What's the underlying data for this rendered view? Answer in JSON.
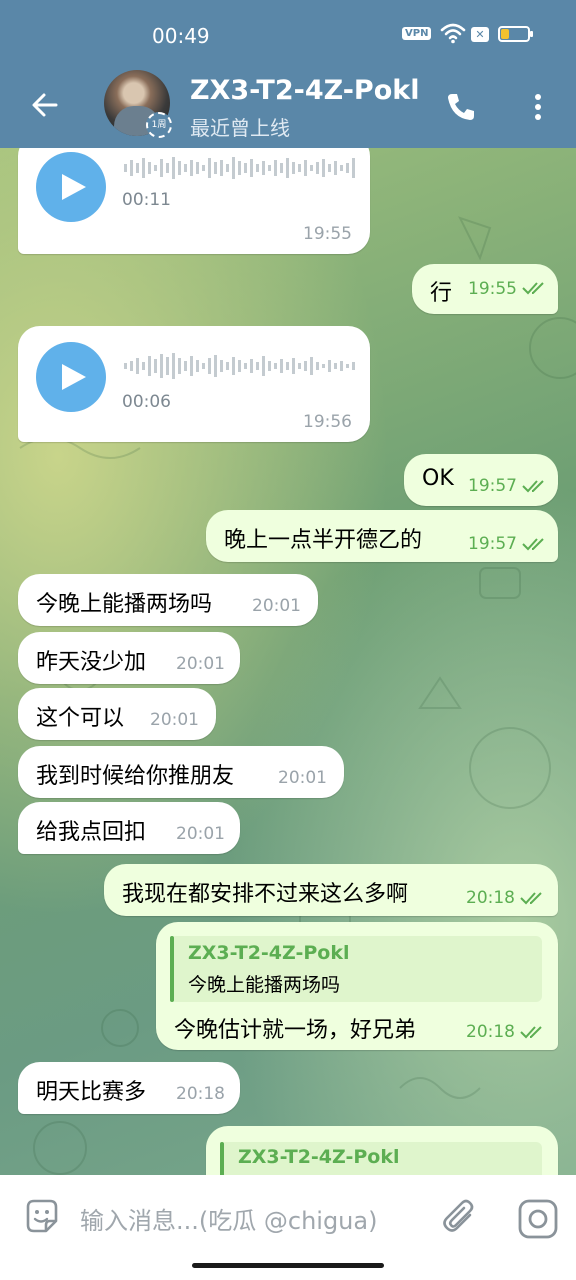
{
  "status_bar": {
    "time": "00:49",
    "vpn": "VPN"
  },
  "header": {
    "title": "ZX3-T2-4Z-Pokl",
    "subtitle": "最近曾上线",
    "badge": "1周"
  },
  "messages": [
    {
      "type": "voice",
      "dir": "in",
      "duration": "00:11",
      "time": "19:55"
    },
    {
      "type": "text",
      "dir": "out",
      "text": "行",
      "time": "19:55"
    },
    {
      "type": "voice",
      "dir": "in",
      "duration": "00:06",
      "time": "19:56"
    },
    {
      "type": "text",
      "dir": "out",
      "text": "OK",
      "time": "19:57"
    },
    {
      "type": "text",
      "dir": "out",
      "text": "晚上一点半开德乙的",
      "time": "19:57"
    },
    {
      "type": "text",
      "dir": "in",
      "text": "今晚上能播两场吗",
      "time": "20:01"
    },
    {
      "type": "text",
      "dir": "in",
      "text": "昨天没少加",
      "time": "20:01"
    },
    {
      "type": "text",
      "dir": "in",
      "text": "这个可以",
      "time": "20:01"
    },
    {
      "type": "text",
      "dir": "in",
      "text": "我到时候给你推朋友",
      "time": "20:01"
    },
    {
      "type": "text",
      "dir": "in",
      "text": "给我点回扣",
      "time": "20:01"
    },
    {
      "type": "text",
      "dir": "out",
      "text": "我现在都安排不过来这么多啊",
      "time": "20:18"
    },
    {
      "type": "reply",
      "dir": "out",
      "reply_name": "ZX3-T2-4Z-Pokl",
      "reply_text": "今晚上能播两场吗",
      "text": "今晚估计就一场，好兄弟",
      "time": "20:18"
    },
    {
      "type": "text",
      "dir": "in",
      "text": "明天比赛多",
      "time": "20:18"
    },
    {
      "type": "reply",
      "dir": "out",
      "reply_name": "ZX3-T2-4Z-Pokl"
    }
  ],
  "composer": {
    "placeholder": "输入消息...(吃瓜 @chigua)"
  },
  "colors": {
    "header": "#5a87a8",
    "outgoing_bubble": "#efffde",
    "incoming_bubble": "#ffffff",
    "accent_green": "#5cae52",
    "play_button": "#60b1ea"
  }
}
